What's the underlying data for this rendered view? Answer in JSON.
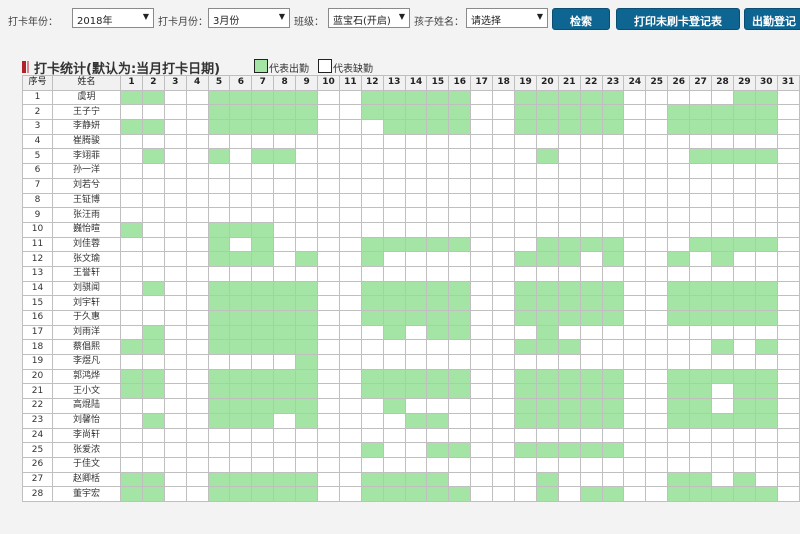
{
  "filters": {
    "year_label": "打卡年份：",
    "year_value": "2018年",
    "month_label": "打卡月份：",
    "month_value": "3月份",
    "class_label": "班级：",
    "class_value": "蓝宝石(开启)",
    "child_label": "孩子姓名：",
    "child_value": "请选择"
  },
  "buttons": {
    "search": "检索",
    "print": "打印未刷卡登记表",
    "attendance": "出勤登记"
  },
  "section": {
    "title": "打卡统计(默认为:当月打卡日期)",
    "legend_present": "代表出勤",
    "legend_absent": "代表缺勤"
  },
  "colors": {
    "present": "#a4e4a4",
    "absent": "#ffffff",
    "button": "#0e6591",
    "title_marker": "#b2222a"
  },
  "table": {
    "col_index": "序号",
    "col_name": "姓名",
    "days": [
      "1",
      "2",
      "3",
      "4",
      "5",
      "6",
      "7",
      "8",
      "9",
      "10",
      "11",
      "12",
      "13",
      "14",
      "15",
      "16",
      "17",
      "18",
      "19",
      "20",
      "21",
      "22",
      "23",
      "24",
      "25",
      "26",
      "27",
      "28",
      "29",
      "30",
      "31"
    ],
    "rows": [
      {
        "idx": "1",
        "name": "虞玥",
        "present": [
          1,
          2,
          5,
          6,
          7,
          8,
          9,
          12,
          13,
          14,
          15,
          16,
          19,
          20,
          21,
          22,
          23,
          29,
          30
        ]
      },
      {
        "idx": "2",
        "name": "王子宁",
        "present": [
          5,
          6,
          7,
          8,
          9,
          12,
          13,
          14,
          15,
          16,
          19,
          20,
          21,
          22,
          23,
          26,
          27,
          28,
          29,
          30
        ]
      },
      {
        "idx": "3",
        "name": "李静妍",
        "present": [
          1,
          2,
          5,
          6,
          7,
          8,
          9,
          13,
          14,
          15,
          16,
          19,
          20,
          21,
          22,
          23,
          26,
          27,
          28,
          29,
          30
        ]
      },
      {
        "idx": "4",
        "name": "崔腾骏",
        "present": []
      },
      {
        "idx": "5",
        "name": "李翊菲",
        "present": [
          2,
          5,
          7,
          8,
          20,
          27,
          28,
          29,
          30
        ]
      },
      {
        "idx": "6",
        "name": "孙一洋",
        "present": []
      },
      {
        "idx": "7",
        "name": "刘若兮",
        "present": []
      },
      {
        "idx": "8",
        "name": "王钲博",
        "present": []
      },
      {
        "idx": "9",
        "name": "张汪雨",
        "present": []
      },
      {
        "idx": "10",
        "name": "巍怡暄",
        "present": [
          1,
          5,
          6,
          7
        ]
      },
      {
        "idx": "11",
        "name": "刘佳蓉",
        "present": [
          5,
          7,
          12,
          13,
          14,
          15,
          16,
          20,
          21,
          22,
          23,
          27,
          28,
          29,
          30
        ]
      },
      {
        "idx": "12",
        "name": "张文瑜",
        "present": [
          5,
          6,
          7,
          9,
          12,
          19,
          20,
          21,
          23,
          26,
          28
        ]
      },
      {
        "idx": "13",
        "name": "王誉轩",
        "present": []
      },
      {
        "idx": "14",
        "name": "刘骐闻",
        "present": [
          2,
          5,
          6,
          7,
          8,
          9,
          12,
          13,
          14,
          15,
          16,
          19,
          20,
          21,
          22,
          23,
          26,
          27,
          28,
          29,
          30
        ]
      },
      {
        "idx": "15",
        "name": "刘宇轩",
        "present": [
          5,
          6,
          7,
          8,
          9,
          12,
          13,
          14,
          15,
          16,
          19,
          20,
          21,
          22,
          23,
          26,
          27,
          28,
          29,
          30
        ]
      },
      {
        "idx": "16",
        "name": "于久惠",
        "present": [
          5,
          6,
          7,
          8,
          9,
          12,
          13,
          14,
          15,
          16,
          19,
          20,
          21,
          22,
          23,
          26,
          27,
          28,
          29,
          30
        ]
      },
      {
        "idx": "17",
        "name": "刘雨洋",
        "present": [
          2,
          5,
          6,
          7,
          8,
          9,
          13,
          15,
          16,
          20
        ]
      },
      {
        "idx": "18",
        "name": "蔡倡熙",
        "present": [
          1,
          2,
          5,
          6,
          7,
          8,
          9,
          19,
          20,
          21,
          28,
          30
        ]
      },
      {
        "idx": "19",
        "name": "李煜凡",
        "present": [
          9
        ]
      },
      {
        "idx": "20",
        "name": "郭鸿烨",
        "present": [
          1,
          2,
          5,
          6,
          7,
          8,
          9,
          12,
          13,
          14,
          15,
          16,
          19,
          20,
          21,
          22,
          23,
          26,
          27,
          28,
          29,
          30
        ]
      },
      {
        "idx": "21",
        "name": "王小文",
        "present": [
          1,
          2,
          5,
          6,
          7,
          8,
          9,
          12,
          13,
          14,
          15,
          16,
          19,
          20,
          21,
          22,
          23,
          26,
          27,
          29,
          30
        ]
      },
      {
        "idx": "22",
        "name": "高焜陆",
        "present": [
          5,
          6,
          7,
          8,
          9,
          13,
          19,
          20,
          21,
          22,
          23,
          26,
          27,
          29,
          30
        ]
      },
      {
        "idx": "23",
        "name": "刘馨怡",
        "present": [
          2,
          5,
          6,
          7,
          9,
          14,
          15,
          19,
          20,
          21,
          22,
          23,
          26,
          27,
          28,
          29,
          30
        ]
      },
      {
        "idx": "24",
        "name": "李尚轩",
        "present": []
      },
      {
        "idx": "25",
        "name": "张爱浓",
        "present": [
          12,
          15,
          16,
          19,
          20,
          21,
          22,
          23
        ]
      },
      {
        "idx": "26",
        "name": "于佳文",
        "present": []
      },
      {
        "idx": "27",
        "name": "赵卿栝",
        "present": [
          1,
          2,
          5,
          6,
          7,
          8,
          9,
          12,
          13,
          14,
          15,
          20,
          26,
          27,
          29
        ]
      },
      {
        "idx": "28",
        "name": "董宇宏",
        "present": [
          1,
          2,
          5,
          6,
          7,
          8,
          9,
          12,
          13,
          14,
          15,
          16,
          20,
          22,
          23,
          26,
          27,
          28,
          29,
          30
        ]
      }
    ]
  }
}
